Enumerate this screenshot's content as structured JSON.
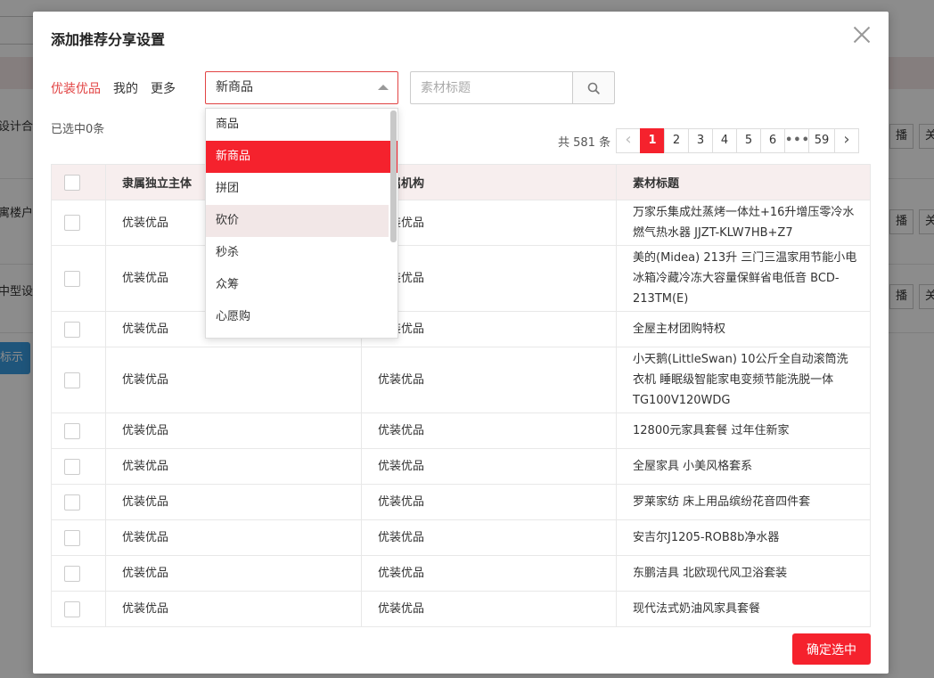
{
  "background": {
    "fragments": [
      "设计合",
      "寓楼户",
      "中型设"
    ],
    "blue_button": "标示",
    "right_buttons": [
      "播",
      "关"
    ]
  },
  "modal": {
    "title": "添加推荐分享设置",
    "tabs": [
      "优装优品",
      "我的",
      "更多"
    ],
    "active_tab": 0,
    "select_value": "新商品",
    "search_placeholder": "素材标题",
    "selected_count": "已选中0条"
  },
  "pagination": {
    "total": "共 581 条",
    "prev": "‹",
    "pages": [
      "1",
      "2",
      "3",
      "4",
      "5",
      "6"
    ],
    "dots": "•••",
    "last": "59",
    "next": "›",
    "current": "1"
  },
  "dropdown": {
    "options": [
      "商品",
      "新商品",
      "拼团",
      "砍价",
      "秒杀",
      "众筹",
      "心愿购"
    ],
    "selected": "新商品",
    "hovered": "砍价"
  },
  "table": {
    "headers": [
      "隶属独立主体",
      "所属机构",
      "素材标题"
    ],
    "rows": [
      {
        "subject": "优装优品",
        "org": "优装优品",
        "title": "万家乐集成灶蒸烤一体灶+16升增压零冷水燃气热水器 JJZT-KLW7HB+Z7"
      },
      {
        "subject": "优装优品",
        "org": "优装优品",
        "title": "美的(Midea) 213升 三门三温家用节能小电冰箱冷藏冷冻大容量保鲜省电低音 BCD-213TM(E)"
      },
      {
        "subject": "优装优品",
        "org": "优装优品",
        "title": "全屋主材团购特权"
      },
      {
        "subject": "优装优品",
        "org": "优装优品",
        "title": "小天鹅(LittleSwan) 10公斤全自动滚筒洗衣机 睡眠级智能家电变频节能洗脱一体 TG100V120WDG"
      },
      {
        "subject": "优装优品",
        "org": "优装优品",
        "title": "12800元家具套餐 过年住新家"
      },
      {
        "subject": "优装优品",
        "org": "优装优品",
        "title": "全屋家具 小美风格套系"
      },
      {
        "subject": "优装优品",
        "org": "优装优品",
        "title": "罗莱家纺 床上用品缤纷花音四件套"
      },
      {
        "subject": "优装优品",
        "org": "优装优品",
        "title": "安吉尔J1205-ROB8b净水器"
      },
      {
        "subject": "优装优品",
        "org": "优装优品",
        "title": "东鹏洁具 北欧现代风卫浴套装"
      },
      {
        "subject": "优装优品",
        "org": "优装优品",
        "title": "现代法式奶油风家具套餐"
      }
    ]
  },
  "confirm_button": "确定选中",
  "colors": {
    "accent": "#f5222d",
    "header_bg": "#f7eeee",
    "hover_bg": "#f2e7e7"
  }
}
